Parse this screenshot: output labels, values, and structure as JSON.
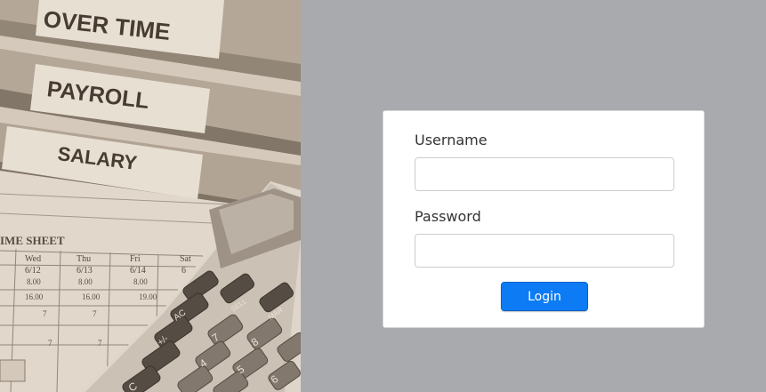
{
  "photo": {
    "folder_labels": [
      "OVER TIME",
      "PAYROLL",
      "SALARY"
    ],
    "sheet_title": "IME SHEET",
    "sheet_days": [
      "Wed",
      "Thu",
      "Fri",
      "Sat"
    ],
    "sheet_dates": [
      "6/12",
      "6/13",
      "6/14",
      "6"
    ],
    "sheet_row1": [
      "8.00",
      "8.00",
      "8.00"
    ],
    "sheet_row2": [
      "16.00",
      "16.00",
      "19.00"
    ],
    "sheet_row3": [
      "7",
      "7"
    ],
    "sheet_row4": [
      "7",
      "7"
    ],
    "calc_keys": [
      "AC",
      "+/-",
      "7",
      "8",
      "4",
      "5",
      "C",
      "6",
      "SELL",
      "MAR"
    ]
  },
  "login": {
    "username_label": "Username",
    "password_label": "Password",
    "username_value": "",
    "password_value": "",
    "login_button": "Login"
  },
  "colors": {
    "page_background": "#a8aaae",
    "button_primary": "#0d7bf4"
  }
}
